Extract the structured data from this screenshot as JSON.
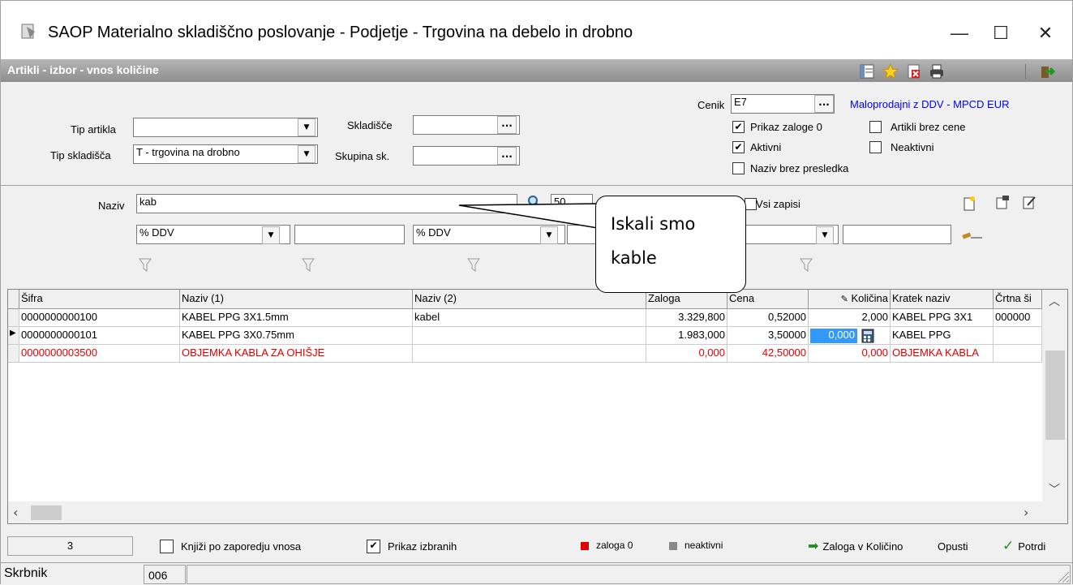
{
  "window": {
    "title": "SAOP Materialno skladiščno poslovanje - Podjetje - Trgovina na debelo in drobno",
    "minimize": "—",
    "maximize": "☐",
    "close": "✕"
  },
  "subwindow": {
    "title": "Artikli - izbor - vnos količine"
  },
  "filters": {
    "tip_artikla_label": "Tip artikla",
    "tip_artikla_value": "",
    "tip_skladisca_label": "Tip skladišča",
    "tip_skladisca_value": "T - trgovina na drobno",
    "skladisce_label": "Skladišče",
    "skladisce_value": "",
    "skupina_label": "Skupina sk.",
    "skupina_value": "",
    "cenik_label": "Cenik",
    "cenik_value": "E7",
    "cenik_desc": "Maloprodajni z DDV - MPCD EUR",
    "dots": "..."
  },
  "checks": {
    "prikaz_zaloge": {
      "label": "Prikaz zaloge 0",
      "checked": "✔"
    },
    "aktivni": {
      "label": "Aktivni",
      "checked": "✔"
    },
    "naziv_brez": {
      "label": "Naziv brez presledka",
      "checked": ""
    },
    "artikli_brez_cene": {
      "label": "Artikli brez cene",
      "checked": ""
    },
    "neaktivni": {
      "label": "Neaktivni",
      "checked": ""
    }
  },
  "search": {
    "naziv_label": "Naziv",
    "naziv_value": "kab",
    "limit": "50",
    "vsi_zapisi": "Vsi zapisi",
    "ddv1": "% DDV",
    "ddv2": "% DDV"
  },
  "callout": {
    "line1": "Iskali  smo",
    "line2": "kable"
  },
  "grid": {
    "columns": [
      "Šifra",
      "Naziv (1)",
      "Naziv (2)",
      "Zaloga",
      "Cena",
      "Količina",
      "Kratek naziv",
      "Črtna ši"
    ],
    "rows": [
      {
        "sifra": "0000000000100",
        "naziv1": "KABEL PPG 3X1.5mm",
        "naziv2": "kabel",
        "zaloga": "3.329,800",
        "cena": "0,52000",
        "kolicina": "2,000",
        "kratek": "KABEL PPG 3X1",
        "crtna": "000000"
      },
      {
        "sifra": "0000000000101",
        "naziv1": "KABEL PPG 3X0.75mm",
        "naziv2": "",
        "zaloga": "1.983,000",
        "cena": "3,50000",
        "kolicina": "0,000",
        "kratek": "KABEL PPG",
        "crtna": ""
      },
      {
        "sifra": "0000000003500",
        "naziv1": "OBJEMKA KABLA ZA OHIŠJE",
        "naziv2": "",
        "zaloga": "0,000",
        "cena": "42,50000",
        "kolicina": "0,000",
        "kratek": "OBJEMKA KABLA",
        "crtna": ""
      }
    ]
  },
  "footer": {
    "count": "3",
    "knjizi_label": "Knjiži po zaporedju vnosa",
    "prikaz_izbranih_label": "Prikaz izbranih",
    "prikaz_izbranih_checked": "✔",
    "legend_zaloga": "zaloga 0",
    "legend_neaktivni": "neaktivni",
    "zaloga_v_kolicino": "Zaloga v Količino",
    "opusti": "Opusti",
    "potrdi": "Potrdi"
  },
  "status": {
    "user": "Skrbnik",
    "code": "006"
  },
  "colors": {
    "red_row": "#e00000",
    "link_blue": "#0000ff",
    "selection": "#3399ff"
  }
}
